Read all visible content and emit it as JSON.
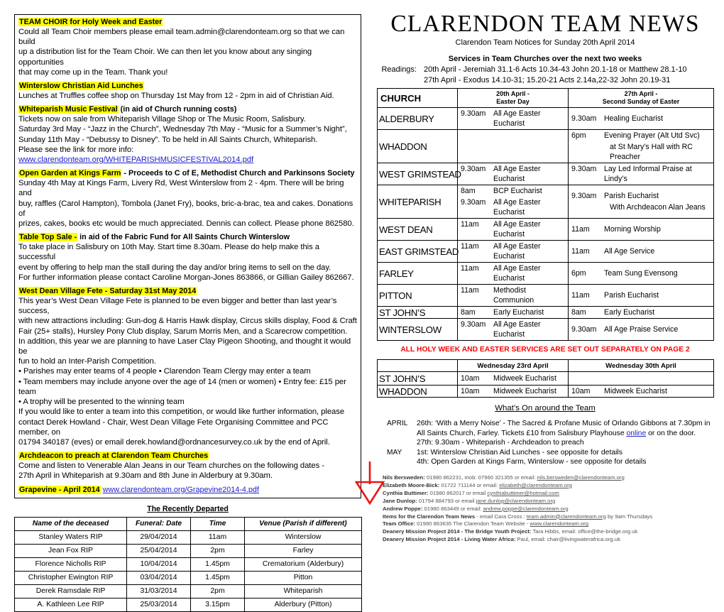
{
  "masthead": {
    "title": "CLARENDON TEAM NEWS",
    "subtitle": "Clarendon Team Notices for Sunday 20th April 2014",
    "services_heading": "Services in Team Churches over the next two weeks",
    "readings_label": "Readings:",
    "readings": [
      "20th April - Jeremiah 31.1-6  Acts 10.34-43  John 20.1-18 or Matthew 28.1-10",
      "27th April - Exodus 14.10-31; 15.20-21  Acts 2.14a,22-32  John 20.19-31"
    ]
  },
  "notices": [
    {
      "heading_hl": "TEAM CHOIR for Holy Week and Easter",
      "heading_rest": "",
      "body": [
        "Could all Team Choir members please email team.admin@clarendonteam.org so that we can build",
        "up a distribution list for the Team Choir. We can then let you know about any singing opportunities",
        "that may come up in the Team. Thank you!"
      ]
    },
    {
      "heading_hl": "Winterslow Christian Aid Lunches",
      "heading_rest": "",
      "body": [
        "Lunches at Truffles coffee shop on Thursday 1st May from 12 - 2pm in aid of Christian Aid."
      ]
    },
    {
      "heading_hl": "Whiteparish Music Festival",
      "heading_rest": " (in aid of Church running costs)",
      "body": [
        "Tickets now on sale from Whiteparish Village Shop or The Music Room, Salisbury.",
        "Saturday 3rd May - “Jazz in the Church”, Wednesday 7th May - “Music for a Summer’s Night”,",
        "Sunday 11th May - “Debussy to Disney”. To be held in All Saints Church, Whiteparish."
      ],
      "body_link_prefix": "Please see the link for more info: ",
      "body_link": "www.clarendonteam.org/WHITEPARISHMUSICFESTIVAL2014.pdf"
    },
    {
      "heading_hl": "Open Garden at Kings Farm",
      "heading_rest": " - Proceeds to C of E, Methodist Church and Parkinsons Society",
      "body": [
        "Sunday 4th May at Kings Farm, Livery Rd, West Winterslow from 2 - 4pm. There will be bring and",
        "buy, raffles (Carol Hampton), Tombola (Janet Fry), books, bric-a-brac, tea and cakes. Donations of",
        "prizes, cakes, books etc would be much appreciated. Dennis can collect. Please phone 862580."
      ]
    },
    {
      "heading_hl": "Table Top Sale -",
      "heading_rest": " in aid of the Fabric Fund for All Saints Church Winterslow",
      "body": [
        "To take place in Salisbury on 10th May. Start time 8.30am. Please do help make this a successful",
        "event by offering to help man the stall during the day and/or bring items to sell on the day.",
        "For further information please contact Caroline Morgan-Jones 863866, or Gillian Gailey 862667."
      ]
    },
    {
      "heading_hl": "West Dean Village Fete - Saturday 31st May 2014",
      "heading_rest": "",
      "body": [
        "This year’s West Dean Village Fete is planned to be even bigger and better than last year’s success,",
        "with new attractions including: Gun-dog & Harris Hawk display, Circus skills display, Food & Craft",
        "Fair (25+ stalls), Hursley Pony Club display, Sarum Morris Men, and a Scarecrow competition.",
        "In addition, this year we are planning to have Laser Clay Pigeon Shooting, and thought it would be",
        "fun to hold an Inter-Parish Competition.",
        "• Parishes may enter teams of 4 people  • Clarendon Team Clergy may enter a team",
        "• Team members may include anyone over the age of 14 (men or women) • Entry fee: £15 per team",
        "• A trophy will be presented to the winning team",
        "If you would like to enter a team into this competition, or would like further information, please",
        "contact Derek Howland - Chair, West Dean Village Fete Organising Committee and PCC member, on",
        "01794 340187 (eves) or email derek.howland@ordnancesurvey.co.uk by the end of April."
      ]
    },
    {
      "heading_hl": "Archdeacon to preach at Clarendon Team Churches",
      "heading_rest": "",
      "body": [
        "Come and listen to Venerable Alan Jeans in our Team churches on the following dates -",
        "27th April in Whiteparish at 9.30am and 8th June in Alderbury at 9.30am."
      ]
    },
    {
      "heading_hl": "Grapevine - April 2014",
      "heading_rest": "",
      "heading_link": "www.clarendonteam.org/Grapevine2014-4.pdf",
      "body": []
    }
  ],
  "departed": {
    "title": "The Recently Departed",
    "headers": [
      "Name of the deceased",
      "Funeral: Date",
      "Time",
      "Venue (Parish if different)"
    ],
    "rows": [
      [
        "Stanley Waters RIP",
        "29/04/2014",
        "11am",
        "Winterslow"
      ],
      [
        "Jean Fox RIP",
        "25/04/2014",
        "2pm",
        "Farley"
      ],
      [
        "Florence Nicholls RIP",
        "10/04/2014",
        "1.45pm",
        "Crematorium (Alderbury)"
      ],
      [
        "Christopher Ewington RIP",
        "03/04/2014",
        "1.45pm",
        "Pitton"
      ],
      [
        "Derek Ramsdale RIP",
        "31/03/2014",
        "2pm",
        "Whiteparish"
      ],
      [
        "A. Kathleen Lee RIP",
        "25/03/2014",
        "3.15pm",
        "Alderbury (Pitton)"
      ]
    ]
  },
  "services_table": {
    "col1_header": "CHURCH",
    "col2_header_line1": "20th April -",
    "col2_header_line2": "Easter Day",
    "col3_header_line1": "27th April -",
    "col3_header_line2": "Second Sunday of Easter",
    "rows": [
      {
        "church": "ALDERBURY",
        "sun20": [
          {
            "time": "9.30am",
            "desc": "All Age Easter Eucharist"
          }
        ],
        "sun27": [
          {
            "time": "9.30am",
            "desc": "Healing Eucharist"
          }
        ]
      },
      {
        "church": "WHADDON",
        "sun20": [],
        "sun27": [
          {
            "time": "6pm",
            "desc": "Evening Prayer (Alt Utd Svc)"
          },
          {
            "time": "",
            "desc": "at St Mary’s Hall with RC Preacher"
          }
        ]
      },
      {
        "church": "WEST GRIMSTEAD",
        "sun20": [
          {
            "time": "9.30am",
            "desc": "All Age Easter Eucharist"
          }
        ],
        "sun27": [
          {
            "time": "9.30am",
            "desc": "Lay Led Informal Praise at Lindy’s"
          }
        ]
      },
      {
        "church": "WHITEPARISH",
        "sun20": [
          {
            "time": "8am",
            "desc": "BCP Eucharist"
          },
          {
            "time": "9.30am",
            "desc": "All Age Easter Eucharist"
          }
        ],
        "sun27": [
          {
            "time": "9.30am",
            "desc": "Parish Eucharist"
          },
          {
            "time": "",
            "desc": "With Archdeacon Alan Jeans"
          }
        ]
      },
      {
        "church": "WEST DEAN",
        "sun20": [
          {
            "time": "11am",
            "desc": "All Age Easter Eucharist"
          }
        ],
        "sun27": [
          {
            "time": "11am",
            "desc": "Morning Worship"
          }
        ]
      },
      {
        "church": "EAST GRIMSTEAD",
        "sun20": [
          {
            "time": "11am",
            "desc": "All Age Easter Eucharist"
          }
        ],
        "sun27": [
          {
            "time": "11am",
            "desc": "All Age Service"
          }
        ]
      },
      {
        "church": "FARLEY",
        "sun20": [
          {
            "time": "11am",
            "desc": "All Age Easter Eucharist"
          }
        ],
        "sun27": [
          {
            "time": "6pm",
            "desc": "Team Sung Evensong"
          }
        ]
      },
      {
        "church": "PITTON",
        "sun20": [
          {
            "time": "11am",
            "desc": "Methodist Communion"
          }
        ],
        "sun27": [
          {
            "time": "11am",
            "desc": "Parish Eucharist"
          }
        ]
      },
      {
        "church": "ST JOHN’S",
        "sun20": [
          {
            "time": "8am",
            "desc": "Early Eucharist"
          }
        ],
        "sun27": [
          {
            "time": "8am",
            "desc": "Early Eucharist"
          }
        ]
      },
      {
        "church": "WINTERSLOW",
        "sun20": [
          {
            "time": "9.30am",
            "desc": "All Age Easter Eucharist"
          }
        ],
        "sun27": [
          {
            "time": "9.30am",
            "desc": "All Age Praise Service"
          }
        ]
      }
    ]
  },
  "holy_week_note": "ALL HOLY WEEK AND EASTER SERVICES ARE SET OUT SEPARATELY ON PAGE 2",
  "midweek_table": {
    "col1_header": "",
    "col2_header": "Wednesday 23rd April",
    "col3_header": "Wednesday 30th April",
    "rows": [
      {
        "church": "ST JOHN’S",
        "wed23": {
          "time": "10am",
          "desc": "Midweek Eucharist"
        },
        "wed30": {
          "time": "",
          "desc": ""
        }
      },
      {
        "church": "WHADDON",
        "wed23": {
          "time": "10am",
          "desc": "Midweek Eucharist"
        },
        "wed30": {
          "time": "10am",
          "desc": "Midweek Eucharist"
        }
      }
    ]
  },
  "whats_on": {
    "title": "What’s On around the Team",
    "groups": [
      {
        "month": "APRIL",
        "items": [
          "26th: ‘With a Merry Noise’ - The Sacred & Profane Music of Orlando Gibbons at 7.30pm in",
          "All Saints Church, Farley. Tickets £10 from Salisbury Playhouse LINK or on the door.",
          "27th: 9.30am - Whiteparish - Archdeadon to preach"
        ],
        "link_text": "online"
      },
      {
        "month": "MAY",
        "items": [
          "1st: Winterslow Christian Aid Lunches - see opposite for details",
          "4th: Open Garden at Kings Farm, Winterslow - see opposite for details"
        ]
      }
    ]
  },
  "contacts": [
    {
      "name": "Nils Bersweden:",
      "rest": " 01980 862231, mob: 07960 321355 or email: ",
      "link": "nils.bersweden@clarendonteam.org",
      "tail": ""
    },
    {
      "name": "Elizabeth Moore-Bick:",
      "rest": " 01722  711144  or email:  ",
      "link": "elizabeth@clarendonteam.org",
      "tail": ""
    },
    {
      "name": "Cynthia Buttimer:",
      "rest": " 01980 862017 or email ",
      "link": "cynthiabuttimer@hotmail.com",
      "tail": ""
    },
    {
      "name": "Jane Dunlop:",
      "rest": "  01794 884793 or email ",
      "link": "jane.dunlop@clarendonteam.org",
      "tail": ""
    },
    {
      "name": "Andrew Poppe:",
      "rest": "  01980  863449 or email:  ",
      "link": "andrew.poppe@clarendonteam.org",
      "tail": ""
    },
    {
      "name": "Items for the Clarendon Team News",
      "rest": " - email Cara Cross : ",
      "link": "team.admin@clarendonteam.org",
      "tail": " by 9am Thursdays"
    },
    {
      "name": "Team Office:",
      "rest": " 01980 863635    The Clarendon Team Website - ",
      "link": "www.clarendonteam.org",
      "tail": ""
    },
    {
      "name": "Deanery Mission Project 2014 - The Bridge Youth Project:",
      "rest": "  Tara Hibbs, email: office@the-bridge.org.uk",
      "link": "",
      "tail": ""
    },
    {
      "name": "Deanery Mission Project 2014 - Living Water Africa:",
      "rest": "   Paul, email:  chair@livingwaterafrica.org.uk",
      "link": "",
      "tail": ""
    }
  ],
  "colors": {
    "highlight": "#ffff00",
    "link": "#2222cc",
    "alert_red": "#ff0000",
    "arrow_red": "#ee1111"
  }
}
